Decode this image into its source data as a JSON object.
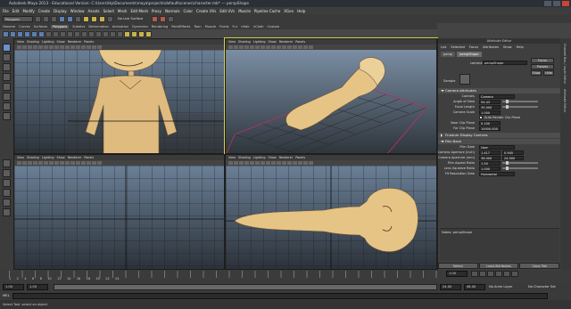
{
  "titlebar": {
    "title": "Autodesk Maya 2013 - Educational Version: C:\\Users\\Hp\\Documents\\maya\\projects\\default\\scenes\\character.mb* --- perspShape"
  },
  "menubar": {
    "items": [
      "File",
      "Edit",
      "Modify",
      "Create",
      "Display",
      "Window",
      "Assets",
      "Select",
      "Mesh",
      "Edit Mesh",
      "Proxy",
      "Normals",
      "Color",
      "Create UVs",
      "Edit UVs",
      "Muscle",
      "Pipeline Cache",
      "XGen",
      "Help"
    ]
  },
  "status": {
    "mode": "Polygons",
    "live_surface": "No Live Surface"
  },
  "shelf": {
    "tabs": [
      "General",
      "Curves",
      "Surfaces",
      "Polygons",
      "Subdivs",
      "Deformation",
      "Animation",
      "Dynamics",
      "Rendering",
      "PaintEffects",
      "Toon",
      "Muscle",
      "Fluids",
      "Fur",
      "nHair",
      "nCloth",
      "Custom"
    ],
    "active": "Polygons"
  },
  "viewport": {
    "menu": [
      "View",
      "Shading",
      "Lighting",
      "Show",
      "Renderer",
      "Panels"
    ]
  },
  "attr": {
    "header": "Attribute Editor",
    "menu": [
      "List",
      "Selected",
      "Focus",
      "Attributes",
      "Show",
      "Help"
    ],
    "tabs": [
      "persp",
      "perspShape"
    ],
    "camera_label": "camera:",
    "camera_value": "perspShape",
    "focus": "Focus",
    "presets": "Presets",
    "show": "Show",
    "hide": "Hide",
    "sample": "Sample",
    "camera_attributes": "Camera Attributes",
    "controls_label": "Controls",
    "controls_value": "Camera",
    "angle_label": "Angle of View",
    "angle_value": "54.43",
    "focal_label": "Focal Length",
    "focal_value": "35.000",
    "scale_label": "Camera Scale",
    "scale_value": "1.000",
    "auto_clip": "Auto Render Clip Plane",
    "near_label": "Near Clip Plane",
    "near_value": "0.100",
    "far_label": "Far Clip Plane",
    "far_value": "10000.000",
    "frustum": "Frustum Display Controls",
    "film_back": "Film Back",
    "filmgate_label": "Film Gate",
    "filmgate_value": "User",
    "aperture_label": "Camera Aperture (inch)",
    "aperture_1": "1.417",
    "aperture_2": "0.945",
    "aperture_mm_label": "Camera Aperture (mm)",
    "aperture_mm_1": "36.000",
    "aperture_mm_2": "24.000",
    "aspect_label": "Film Aspect Ratio",
    "aspect_value": "1.50",
    "squeeze_label": "Lens Squeeze Ratio",
    "squeeze_value": "1.000",
    "fitres_label": "Fit Resolution Gate",
    "fitres_value": "Horizontal",
    "notes": "Notes:  perspShape",
    "select": "Select",
    "load": "Load Attributes",
    "copy": "Copy Tab"
  },
  "rightside": {
    "a": "Channel Box / Layer Editor",
    "b": "Attribute Editor"
  },
  "timeline": {
    "ticks": [
      "1",
      "2",
      "4",
      "6",
      "8",
      "10",
      "12",
      "14",
      "16",
      "18",
      "20",
      "22",
      "24"
    ],
    "current": "1.00"
  },
  "range": {
    "start": "1.00",
    "inner_start": "1.00",
    "inner_end": "24.00",
    "end1": "24.00",
    "end2": "48.00",
    "anim_layer": "No Anim Layer",
    "char_set": "No Character Set"
  },
  "cmd": {
    "label": "MEL"
  },
  "help": "Select Tool: select an object"
}
